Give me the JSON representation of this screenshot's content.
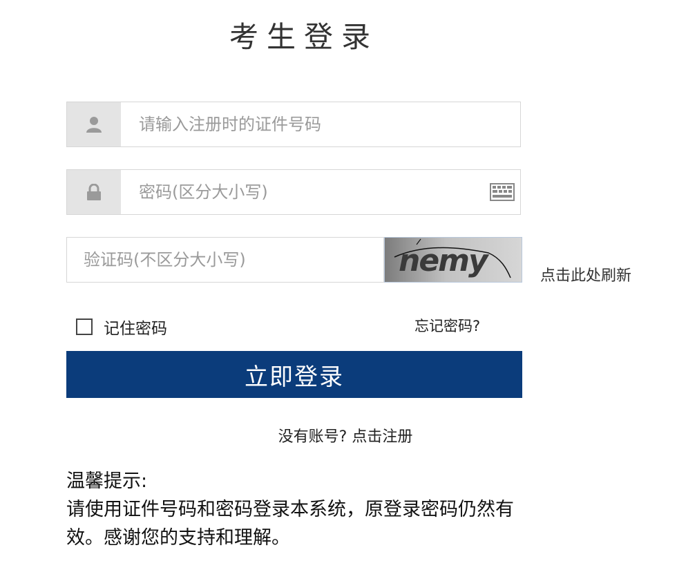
{
  "title": "考生登录",
  "id_field": {
    "placeholder": "请输入注册时的证件号码",
    "icon": "user-icon"
  },
  "password_field": {
    "placeholder": "密码(区分大小写)",
    "icon": "lock-icon",
    "keyboard_icon": "keyboard-icon"
  },
  "captcha": {
    "placeholder": "验证码(不区分大小写)",
    "code": "nemy",
    "refresh_label": "点击此处刷新"
  },
  "remember_label": "记住密码",
  "forgot_label": "忘记密码?",
  "login_button": "立即登录",
  "register_link": "没有账号? 点击注册",
  "notice": {
    "heading": "温馨提示:",
    "body": "请使用证件号码和密码登录本系统，原登录密码仍然有效。感谢您的支持和理解。"
  },
  "colors": {
    "primary": "#0b3c7b",
    "icon_bg": "#e4e4e4",
    "border": "#d6d6d6",
    "placeholder": "#9a9a9a"
  }
}
